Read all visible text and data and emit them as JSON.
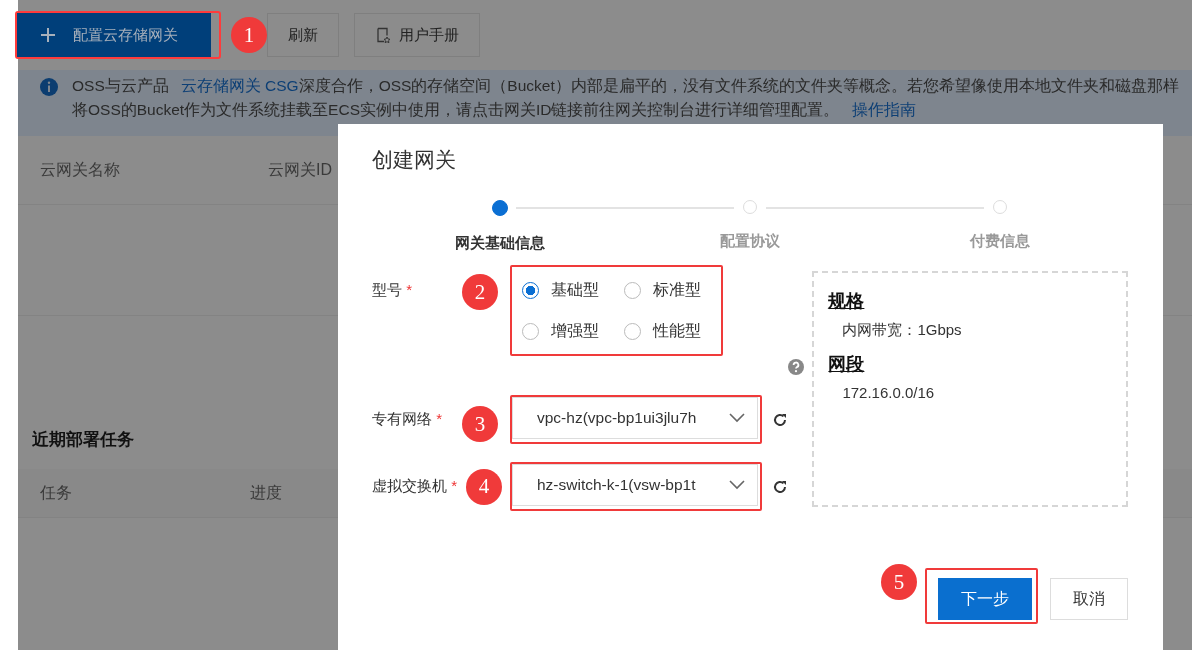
{
  "toolbar": {
    "buttons": [
      {
        "label": "配置云存储网关",
        "kind": "primary",
        "callout": "1"
      },
      {
        "label": "刷新",
        "kind": "plain"
      },
      {
        "label": "用户手册",
        "kind": "manual"
      }
    ]
  },
  "notice": {
    "lines": [
      [
        {
          "text": "OSS与云产品",
          "kind": "text"
        },
        {
          "text": "云存储网关 CSG",
          "kind": "link"
        },
        {
          "text": "深度合作，OSS的存储空间（Bucket）内部是扁平的，没有文件系统的文件夹等概念。若您希望像使用本地文件夹和磁盘那样",
          "kind": "text"
        }
      ],
      [
        {
          "text": "将OSS的Bucket作为文件系统挂载至ECS实例中使用，请点击网关ID链接前往网关控制台进行详细管理配置。",
          "kind": "text"
        },
        {
          "text": "操作指南",
          "kind": "link"
        }
      ]
    ]
  },
  "gateway_table": {
    "columns": [
      "云网关名称",
      "云网关ID"
    ]
  },
  "tasks": {
    "title": "近期部署任务",
    "columns": [
      "任务",
      "进度"
    ]
  },
  "dialog": {
    "title": "创建网关",
    "steps": [
      {
        "label": "网关基础信息",
        "selected": true
      },
      {
        "label": "配置协议",
        "selected": false
      },
      {
        "label": "付费信息",
        "selected": false
      }
    ],
    "fields": [
      {
        "kind": "radio",
        "label": "型号",
        "required_mark": "*",
        "callout": "2",
        "options": [
          {
            "label": "基础型",
            "selected": true
          },
          {
            "label": "标准型",
            "selected": false
          },
          {
            "label": "增强型",
            "selected": false
          },
          {
            "label": "性能型",
            "selected": false
          }
        ]
      },
      {
        "kind": "select",
        "label": "专有网络",
        "required_mark": "*",
        "callout": "3",
        "value": "vpc-hz(vpc-bp1ui3jlu7h"
      },
      {
        "kind": "select",
        "label": "虚拟交换机",
        "required_mark": "*",
        "callout": "4",
        "value": "hz-switch-k-1(vsw-bp1t"
      }
    ],
    "spec_panel": {
      "sections": [
        {
          "heading": "规格",
          "value": "内网带宽：1Gbps"
        },
        {
          "heading": "网段",
          "value": "172.16.0.0/16"
        }
      ]
    },
    "buttons": [
      {
        "label": "下一步",
        "kind": "primary",
        "callout": "5"
      },
      {
        "label": "取消",
        "kind": "secondary"
      }
    ]
  }
}
